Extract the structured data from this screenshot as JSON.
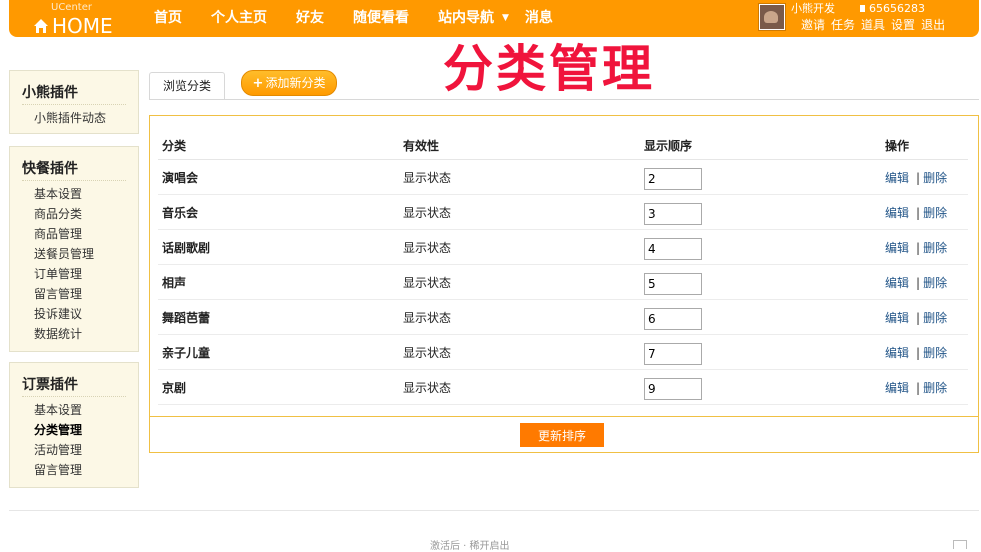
{
  "header": {
    "logo_top": "UCenter",
    "logo_main": "HOME",
    "nav": [
      "首页",
      "个人主页",
      "好友",
      "随便看看",
      "站内导航",
      "消息"
    ],
    "username": "小熊开发",
    "credits": "65656283",
    "user_links": [
      "邀请",
      "任务",
      "道具",
      "设置",
      "退出"
    ]
  },
  "sidebar": [
    {
      "title": "小熊插件",
      "items": [
        "小熊插件动态"
      ]
    },
    {
      "title": "快餐插件",
      "items": [
        "基本设置",
        "商品分类",
        "商品管理",
        "送餐员管理",
        "订单管理",
        "留言管理",
        "投诉建议",
        "数据统计"
      ]
    },
    {
      "title": "订票插件",
      "items": [
        "基本设置",
        "分类管理",
        "活动管理",
        "留言管理"
      ],
      "active": "分类管理"
    }
  ],
  "tabs": {
    "browse": "浏览分类",
    "add": "添加新分类"
  },
  "banner": "分类管理",
  "table": {
    "headers": [
      "分类",
      "有效性",
      "显示顺序",
      "操作"
    ],
    "rows": [
      {
        "name": "演唱会",
        "status": "显示状态",
        "order": "2"
      },
      {
        "name": "音乐会",
        "status": "显示状态",
        "order": "3"
      },
      {
        "name": "话剧歌剧",
        "status": "显示状态",
        "order": "4"
      },
      {
        "name": "相声",
        "status": "显示状态",
        "order": "5"
      },
      {
        "name": "舞蹈芭蕾",
        "status": "显示状态",
        "order": "6"
      },
      {
        "name": "亲子儿童",
        "status": "显示状态",
        "order": "7"
      },
      {
        "name": "京剧",
        "status": "显示状态",
        "order": "9"
      }
    ],
    "edit": "编辑",
    "sep": "|",
    "del": "删除"
  },
  "update_button": "更新排序",
  "footer_text": "激活后 · 稀开启出"
}
